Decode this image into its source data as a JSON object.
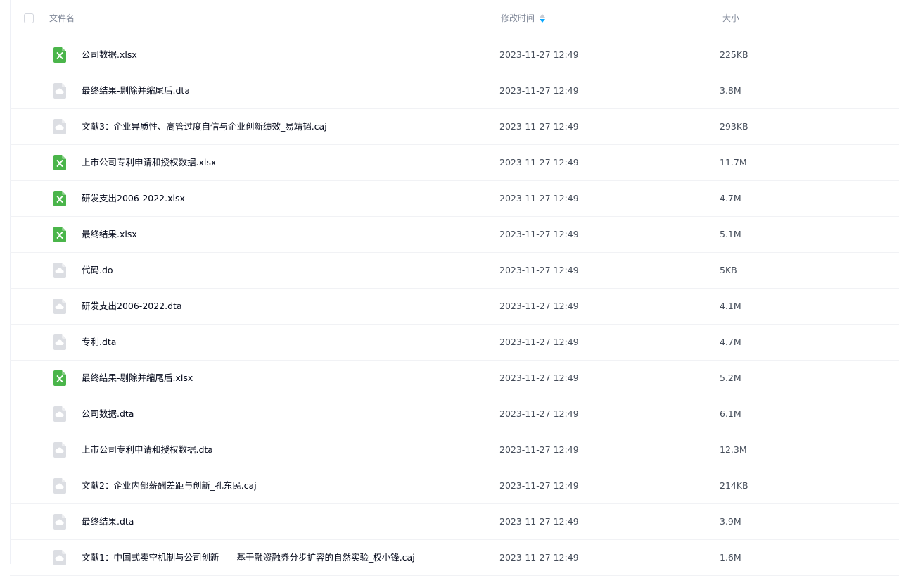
{
  "header": {
    "name_label": "文件名",
    "time_label": "修改时间",
    "size_label": "大小",
    "sort_icon": "sort-desc-icon",
    "sort_active_color": "#06a7ff"
  },
  "colors": {
    "excel_icon": "#4ab54a",
    "generic_icon": "#dcdee3"
  },
  "files": [
    {
      "name": "公司数据.xlsx",
      "time": "2023-11-27 12:49",
      "size": "225KB",
      "icon": "excel-icon"
    },
    {
      "name": "最终结果-剔除并缩尾后.dta",
      "time": "2023-11-27 12:49",
      "size": "3.8M",
      "icon": "file-icon"
    },
    {
      "name": "文献3：企业异质性、高管过度自信与企业创新绩效_易靖韬.caj",
      "time": "2023-11-27 12:49",
      "size": "293KB",
      "icon": "file-icon"
    },
    {
      "name": "上市公司专利申请和授权数据.xlsx",
      "time": "2023-11-27 12:49",
      "size": "11.7M",
      "icon": "excel-icon"
    },
    {
      "name": "研发支出2006-2022.xlsx",
      "time": "2023-11-27 12:49",
      "size": "4.7M",
      "icon": "excel-icon"
    },
    {
      "name": "最终结果.xlsx",
      "time": "2023-11-27 12:49",
      "size": "5.1M",
      "icon": "excel-icon"
    },
    {
      "name": "代码.do",
      "time": "2023-11-27 12:49",
      "size": "5KB",
      "icon": "file-icon"
    },
    {
      "name": "研发支出2006-2022.dta",
      "time": "2023-11-27 12:49",
      "size": "4.1M",
      "icon": "file-icon"
    },
    {
      "name": "专利.dta",
      "time": "2023-11-27 12:49",
      "size": "4.7M",
      "icon": "file-icon"
    },
    {
      "name": "最终结果-剔除并缩尾后.xlsx",
      "time": "2023-11-27 12:49",
      "size": "5.2M",
      "icon": "excel-icon"
    },
    {
      "name": "公司数据.dta",
      "time": "2023-11-27 12:49",
      "size": "6.1M",
      "icon": "file-icon"
    },
    {
      "name": "上市公司专利申请和授权数据.dta",
      "time": "2023-11-27 12:49",
      "size": "12.3M",
      "icon": "file-icon"
    },
    {
      "name": "文献2：企业内部薪酬差距与创新_孔东民.caj",
      "time": "2023-11-27 12:49",
      "size": "214KB",
      "icon": "file-icon"
    },
    {
      "name": "最终结果.dta",
      "time": "2023-11-27 12:49",
      "size": "3.9M",
      "icon": "file-icon"
    },
    {
      "name": "文献1：中国式卖空机制与公司创新——基于融资融券分步扩容的自然实验_权小锋.caj",
      "time": "2023-11-27 12:49",
      "size": "1.6M",
      "icon": "file-icon"
    }
  ]
}
